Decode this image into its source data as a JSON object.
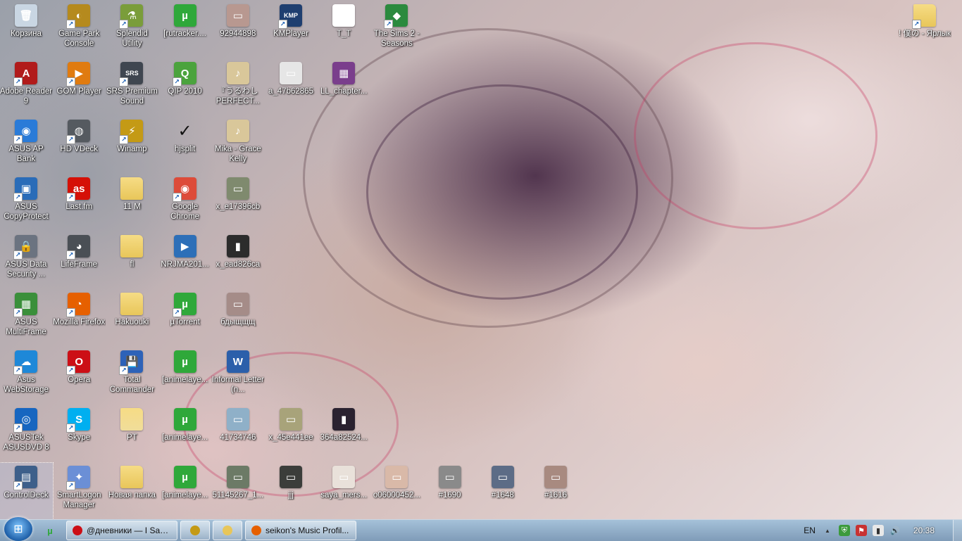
{
  "desktop": {
    "columns": [
      {
        "items": [
          {
            "label": "Корзина",
            "icon": "recycle-bin-icon",
            "glyph": "🗑",
            "color": "#c9d6e3"
          },
          {
            "label": "Adobe Reader 9",
            "icon": "adobe-reader-icon",
            "glyph": "A",
            "color": "#b11b1b",
            "shortcut": true
          },
          {
            "label": "ASUS AP Bank",
            "icon": "asus-ap-bank-icon",
            "glyph": "◉",
            "color": "#2a7bd8",
            "shortcut": true
          },
          {
            "label": "ASUS CopyProtect",
            "icon": "asus-copyprotect-icon",
            "glyph": "▣",
            "color": "#2a6cb8",
            "shortcut": true
          },
          {
            "label": "ASUS Data Security ...",
            "icon": "asus-data-security-icon",
            "glyph": "🔒",
            "color": "#6b7380",
            "shortcut": true
          },
          {
            "label": "ASUS MultiFrame",
            "icon": "asus-multiframe-icon",
            "glyph": "▦",
            "color": "#3a8f3a",
            "shortcut": true
          },
          {
            "label": "Asus WebStorage",
            "icon": "asus-webstorage-icon",
            "glyph": "☁",
            "color": "#1e88d8",
            "shortcut": true
          },
          {
            "label": "ASUSTek ASUSDVD 8",
            "icon": "asus-dvd-icon",
            "glyph": "◎",
            "color": "#1766c0",
            "shortcut": true
          },
          {
            "label": "ControlDeck",
            "icon": "controldeck-icon",
            "glyph": "▤",
            "color": "#3d5f8a",
            "shortcut": true,
            "selected": true
          }
        ]
      },
      {
        "items": [
          {
            "label": "Game Park Console",
            "icon": "game-park-icon",
            "glyph": "◐",
            "color": "#b58a1e",
            "shortcut": true
          },
          {
            "label": "GOM Player",
            "icon": "gom-player-icon",
            "glyph": "▶",
            "color": "#e07b10",
            "shortcut": true
          },
          {
            "label": "HD VDeck",
            "icon": "hd-vdeck-icon",
            "glyph": "◍",
            "color": "#555a60",
            "shortcut": true
          },
          {
            "label": "Last.fm",
            "icon": "lastfm-icon",
            "glyph": "as",
            "color": "#d51007",
            "shortcut": true
          },
          {
            "label": "LifeFrame",
            "icon": "lifeframe-icon",
            "glyph": "◕",
            "color": "#4a4f55",
            "shortcut": true
          },
          {
            "label": "Mozilla Firefox",
            "icon": "firefox-icon",
            "glyph": "◔",
            "color": "#e66000",
            "shortcut": true
          },
          {
            "label": "Opera",
            "icon": "opera-icon",
            "glyph": "O",
            "color": "#cc0f16",
            "shortcut": true
          },
          {
            "label": "Skype",
            "icon": "skype-icon",
            "glyph": "S",
            "color": "#00aff0",
            "shortcut": true
          },
          {
            "label": "SmartLogon Manager",
            "icon": "smartlogon-icon",
            "glyph": "✦",
            "color": "#6b8fd6",
            "shortcut": true
          }
        ]
      },
      {
        "items": [
          {
            "label": "Splendid Utility",
            "icon": "splendid-utility-icon",
            "glyph": "⚗",
            "color": "#7a9d3a",
            "shortcut": true
          },
          {
            "label": "SRS Premium Sound",
            "icon": "srs-sound-icon",
            "glyph": "SRS",
            "color": "#3f4650",
            "shortcut": true
          },
          {
            "label": "Winamp",
            "icon": "winamp-icon",
            "glyph": "⚡",
            "color": "#c49a15",
            "shortcut": true
          },
          {
            "label": "11 M",
            "icon": "folder-icon",
            "glyph": "",
            "color": "#e8c65a"
          },
          {
            "label": "fl",
            "icon": "folder-icon",
            "glyph": "",
            "color": "#e8c65a"
          },
          {
            "label": "Hakuouki",
            "icon": "folder-icon",
            "glyph": "",
            "color": "#e8c65a"
          },
          {
            "label": "Total Commander",
            "icon": "total-commander-icon",
            "glyph": "💾",
            "color": "#2d62b8",
            "shortcut": true
          },
          {
            "label": "PT",
            "icon": "folder-icon",
            "glyph": "",
            "color": "#f0dd9a"
          },
          {
            "label": "Новая папка",
            "icon": "folder-icon",
            "glyph": "",
            "color": "#e8c65a"
          }
        ]
      },
      {
        "items": [
          {
            "label": "[rutracker....",
            "icon": "utorrent-icon",
            "glyph": "µ",
            "color": "#2fa83a"
          },
          {
            "label": "QIP 2010",
            "icon": "qip-icon",
            "glyph": "Q",
            "color": "#4ba33d",
            "shortcut": true
          },
          {
            "label": "hjsplit",
            "icon": "checkmark-icon",
            "glyph": "✓",
            "color": "rgba(0,0,0,0)"
          },
          {
            "label": "Google Chrome",
            "icon": "chrome-icon",
            "glyph": "◉",
            "color": "#dd4b39",
            "shortcut": true
          },
          {
            "label": "NRJMA201...",
            "icon": "media-file-icon",
            "glyph": "▶",
            "color": "#2d6fb8"
          },
          {
            "label": "µTorrent",
            "icon": "utorrent-icon",
            "glyph": "µ",
            "color": "#2fa83a",
            "shortcut": true
          },
          {
            "label": "[animelaye...",
            "icon": "utorrent-icon",
            "glyph": "µ",
            "color": "#2fa83a"
          },
          {
            "label": "[animelaye...",
            "icon": "utorrent-icon",
            "glyph": "µ",
            "color": "#2fa83a"
          },
          {
            "label": "[animelaye...",
            "icon": "utorrent-icon",
            "glyph": "µ",
            "color": "#2fa83a"
          }
        ]
      },
      {
        "items": [
          {
            "label": "92944898",
            "icon": "image-file-icon",
            "glyph": "▭",
            "color": "#b89890"
          },
          {
            "label": "『うるわし PERFECT...",
            "icon": "audio-file-icon",
            "glyph": "♪",
            "color": "#d9c79a"
          },
          {
            "label": "Mika - Grace Kelly",
            "icon": "audio-file-icon",
            "glyph": "♪",
            "color": "#d9c79a"
          },
          {
            "label": "x_e17396cb",
            "icon": "image-file-icon",
            "glyph": "▭",
            "color": "#7f8a6e"
          },
          {
            "label": "x_ead826ca",
            "icon": "image-file-icon",
            "glyph": "▮",
            "color": "#2c2c2c"
          },
          {
            "label": "бдыщщщ",
            "icon": "image-file-icon",
            "glyph": "▭",
            "color": "#a58c88"
          },
          {
            "label": "Informal Letter (n...",
            "icon": "word-document-icon",
            "glyph": "W",
            "color": "#2b5faa"
          },
          {
            "label": "41734746",
            "icon": "image-file-icon",
            "glyph": "▭",
            "color": "#8fb0c8"
          },
          {
            "label": "51145267_1...",
            "icon": "image-file-icon",
            "glyph": "▭",
            "color": "#6c7a66"
          }
        ]
      },
      {
        "items": [
          {
            "label": "KMPlayer",
            "icon": "kmplayer-icon",
            "glyph": "KMP",
            "color": "#1f3f70",
            "shortcut": true
          },
          {
            "label": "a_47b62865",
            "icon": "image-file-icon",
            "glyph": "▭",
            "color": "#e6e6e6"
          },
          {
            "label": "x_45e441ee",
            "icon": "image-file-icon",
            "glyph": "▭",
            "color": "#a8a37a"
          },
          {
            "label": "jjj",
            "icon": "image-file-icon",
            "glyph": "▭",
            "color": "#3b3d3a"
          }
        ]
      },
      {
        "items": [
          {
            "label": "T_T",
            "icon": "blank-file-icon",
            "glyph": "",
            "color": "#ffffff"
          },
          {
            "label": "LL_chapter...",
            "icon": "winrar-archive-icon",
            "glyph": "▦",
            "color": "#7a3e8c"
          },
          {
            "label": "364a82524...",
            "icon": "image-file-icon",
            "glyph": "▮",
            "color": "#2a2230"
          },
          {
            "label": "saya_mers...",
            "icon": "image-file-icon",
            "glyph": "▭",
            "color": "#e9e1da"
          }
        ]
      },
      {
        "items": [
          {
            "label": "The Sims 2 - Seasons",
            "icon": "sims2-icon",
            "glyph": "◆",
            "color": "#2b8a3e",
            "shortcut": true
          },
          {
            "label": "o06000452...",
            "icon": "image-file-icon",
            "glyph": "▭",
            "color": "#d9b9a8"
          }
        ]
      },
      {
        "items": [
          {
            "label": "#1690",
            "icon": "image-file-icon",
            "glyph": "▭",
            "color": "#8a8a8a"
          }
        ]
      },
      {
        "items": [
          {
            "label": "#1648",
            "icon": "image-file-icon",
            "glyph": "▭",
            "color": "#5c6c86"
          }
        ]
      },
      {
        "items": [
          {
            "label": "#1616",
            "icon": "image-file-icon",
            "glyph": "▭",
            "color": "#a88a80"
          }
        ]
      },
      {
        "items": [
          {
            "label": "! 僕の - Ярлык",
            "icon": "folder-shortcut-icon",
            "glyph": "",
            "color": "#e8c65a",
            "shortcut": true
          }
        ]
      }
    ]
  },
  "taskbar": {
    "start_label": "Start",
    "quick_launch": [
      {
        "icon": "utorrent-quick-icon",
        "glyph": "µ",
        "color": "#2fa83a"
      }
    ],
    "tasks": [
      {
        "label": "@дневники — I Say ...",
        "icon": "opera-task-icon",
        "color": "#cc0f16"
      },
      {
        "label": "",
        "icon": "winamp-task-icon",
        "color": "#c49a15"
      },
      {
        "label": "",
        "icon": "explorer-task-icon",
        "color": "#e8c65a"
      },
      {
        "label": "seikon's Music Profil...",
        "icon": "firefox-task-icon",
        "color": "#e66000"
      }
    ],
    "tray": {
      "language": "EN",
      "clock": "20:38",
      "icons": [
        "show-hidden-icon",
        "network-shield-icon",
        "flag-icon",
        "battery-icon",
        "volume-icon"
      ]
    }
  }
}
